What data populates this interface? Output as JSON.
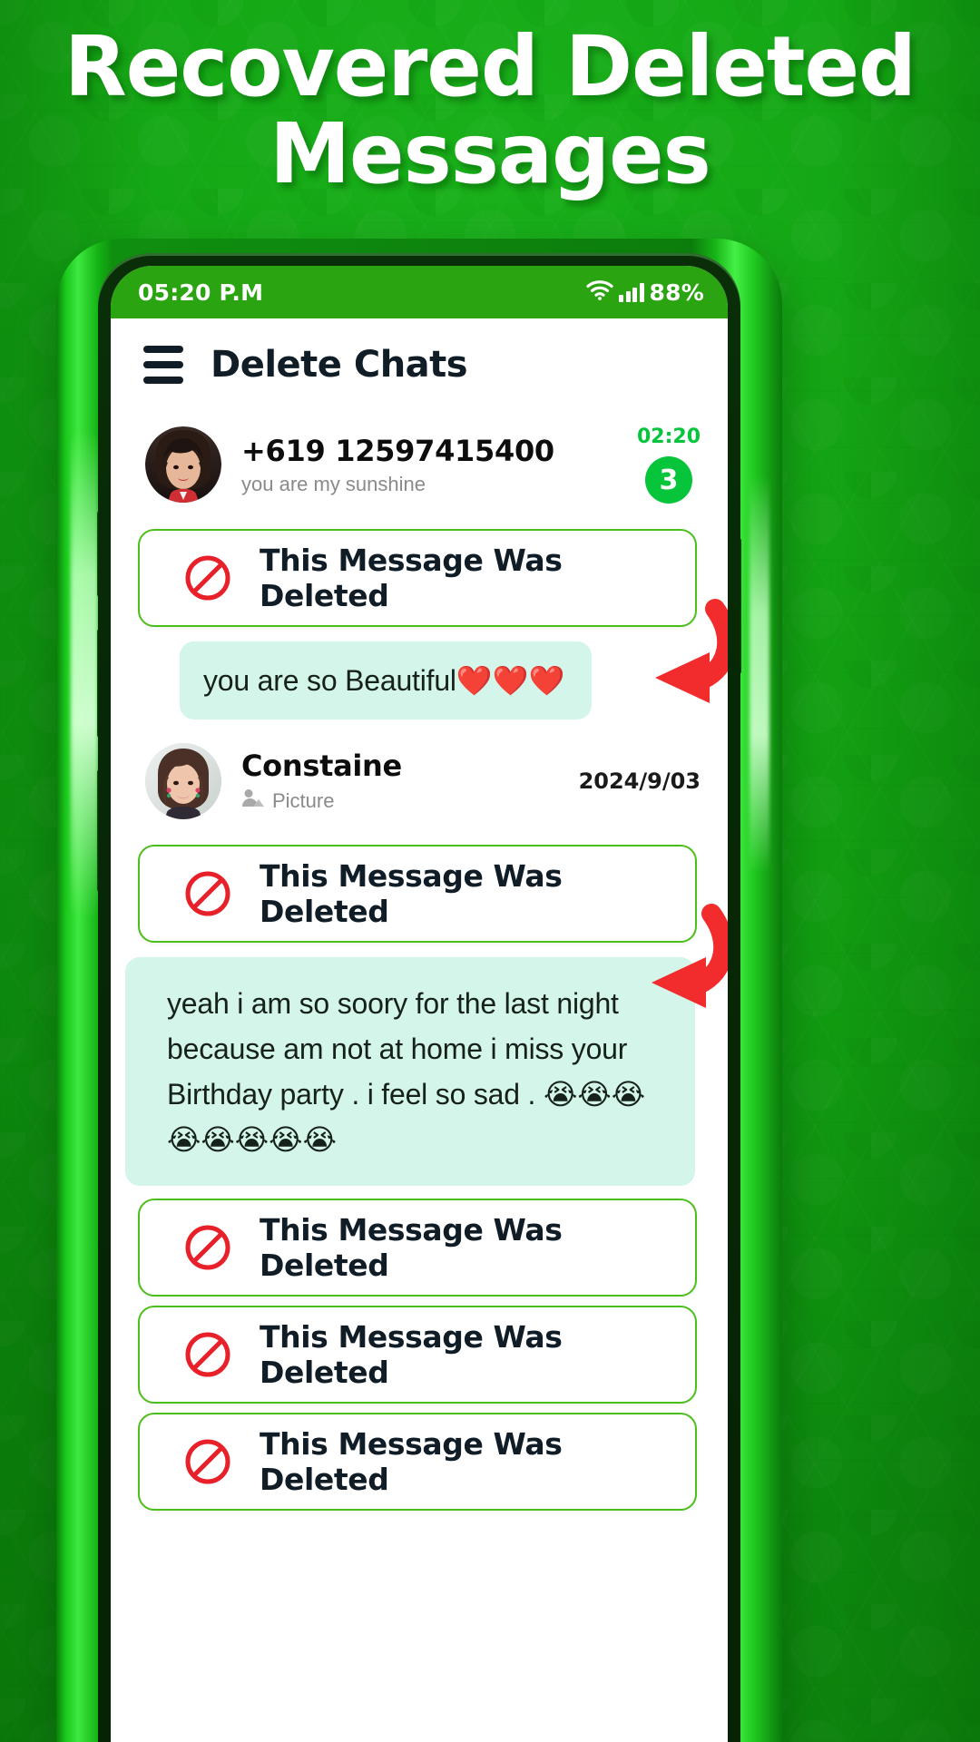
{
  "headline": {
    "line1": "Recovered Deleted",
    "line2": "Messages"
  },
  "colors": {
    "brand_green": "#16a316",
    "accent_green": "#06c53a",
    "card_border": "#4cbe19",
    "bubble_bg": "#d4f5e9",
    "title_navy": "#101c26",
    "deleted_red": "#e8202a",
    "statusbar_green": "#2aa411"
  },
  "statusbar": {
    "time": "05:20 P.M",
    "wifi_icon": "wifi-icon",
    "signal_icon": "signal-bars-icon",
    "battery": "88%"
  },
  "appbar": {
    "menu_icon": "hamburger-menu-icon",
    "title": "Delete Chats"
  },
  "chat": {
    "items": [
      {
        "kind": "contact",
        "avatar": "woman-red-scarf-avatar",
        "name": "+619 12597415400",
        "subtitle": "you are my sunshine",
        "time": "02:20",
        "badge": "3"
      },
      {
        "kind": "deleted",
        "icon": "prohibited-sign-icon",
        "text": "This Message Was Deleted"
      },
      {
        "kind": "bubble",
        "text": "you are so Beautiful",
        "emoji": "❤️❤️❤️",
        "arrow": "red-curved-arrow-icon"
      },
      {
        "kind": "contact",
        "avatar": "woman-smiling-earrings-avatar",
        "name": "Constaine",
        "subtitle": "Picture",
        "subtitle_icon": "picture-person-icon",
        "date": "2024/9/03"
      },
      {
        "kind": "deleted",
        "icon": "prohibited-sign-icon",
        "text": "This Message Was Deleted"
      },
      {
        "kind": "bubble",
        "text": "yeah i am so soory for the last night because am not at home i miss your Birthday party . i feel so sad .",
        "emoji": "😭😭😭😭😭😭😭😭",
        "arrow": "red-curved-arrow-icon"
      },
      {
        "kind": "deleted",
        "icon": "prohibited-sign-icon",
        "text": "This Message Was Deleted"
      },
      {
        "kind": "deleted",
        "icon": "prohibited-sign-icon",
        "text": "This Message Was Deleted"
      },
      {
        "kind": "deleted",
        "icon": "prohibited-sign-icon",
        "text": "This Message Was Deleted"
      }
    ]
  }
}
